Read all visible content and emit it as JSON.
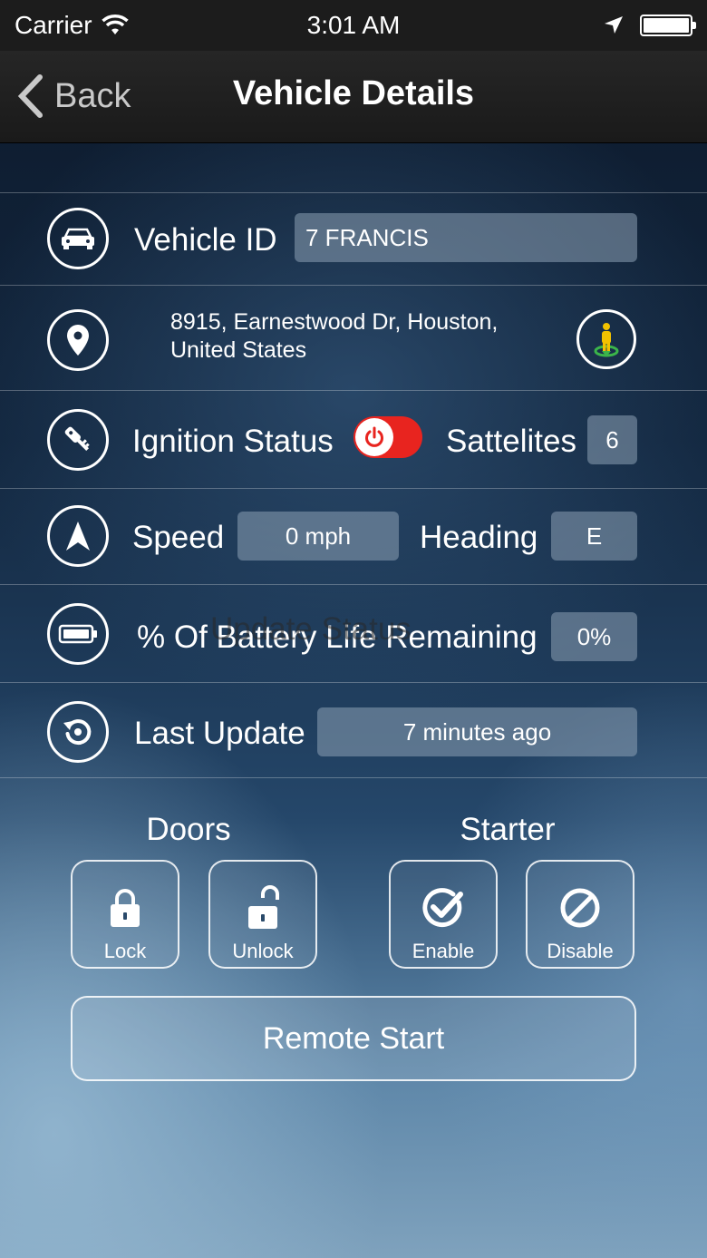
{
  "status_bar": {
    "carrier": "Carrier",
    "time": "3:01 AM"
  },
  "nav": {
    "back_label": "Back",
    "title": "Vehicle Details"
  },
  "vehicle_id": {
    "label": "Vehicle ID",
    "value": "7 FRANCIS"
  },
  "location": {
    "line1": "8915, Earnestwood Dr, Houston,",
    "line2": "United States"
  },
  "ignition": {
    "label": "Ignition Status",
    "satellites_label": "Sattelites",
    "satellites_value": "6"
  },
  "speed": {
    "label": "Speed",
    "value": "0 mph",
    "heading_label": "Heading",
    "heading_value": "E"
  },
  "battery": {
    "label": "% Of Battery Life Remaining",
    "value": "0%",
    "overlay_text": "Update Status"
  },
  "last_update": {
    "label": "Last Update",
    "value": "7 minutes ago"
  },
  "doors": {
    "label": "Doors",
    "lock_label": "Lock",
    "unlock_label": "Unlock"
  },
  "starter": {
    "label": "Starter",
    "enable_label": "Enable",
    "disable_label": "Disable"
  },
  "remote_start_label": "Remote Start",
  "colors": {
    "toggle_off": "#e8241f",
    "field_bg": "#8ca0b4",
    "nav_bg": "#1a1a1a",
    "pin_accent": "#f2c200",
    "pin_ring": "#3bb54a"
  }
}
